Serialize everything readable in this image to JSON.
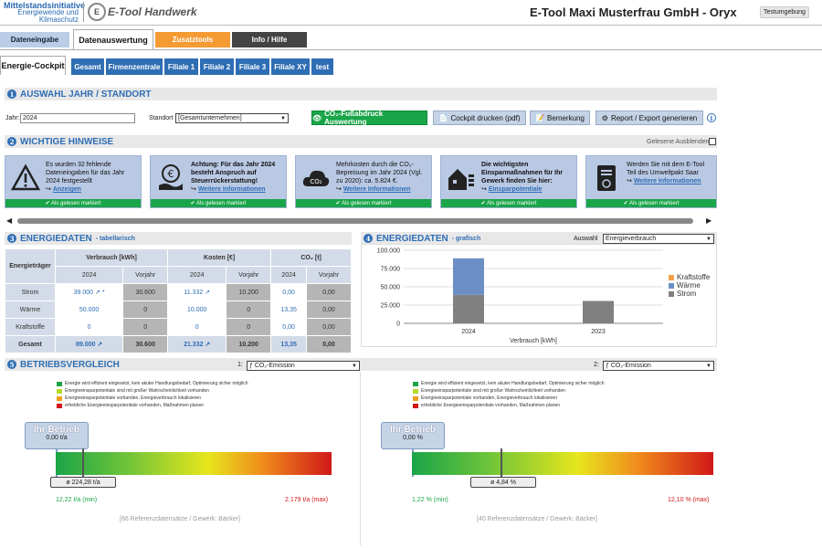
{
  "header": {
    "logo_line1": "Mittelstandsinitiative",
    "logo_line2": "Energiewende und",
    "logo_line3": "Klimaschutz",
    "logo2_mark": "E",
    "logo2_text": "E-Tool Handwerk",
    "app_title": "E-Tool Maxi Musterfrau GmbH - Oryx",
    "env_badge": "Testumgebung"
  },
  "main_tabs": [
    "Dateneingabe",
    "Datenauswertung",
    "Zusatztools",
    "Info / Hilfe"
  ],
  "sub_tabs": [
    "Energie-Cockpit",
    "Gesamt",
    "Firmenzentrale",
    "Filiale 1",
    "Filiale 2",
    "Filiale 3",
    "Filiale XY",
    "test"
  ],
  "section1": {
    "num": "1",
    "title": "AUSWAHL JAHR / STANDORT",
    "jahr_label": "Jahr:",
    "jahr_value": "2024",
    "standort_label": "Standort",
    "standort_value": "[Gesamtunternehmen]",
    "btn_co2": "CO₂-Fußabdruck Auswertung",
    "btn_print": "Cockpit drucken (pdf)",
    "btn_note": "Bemerkung",
    "btn_report": "Report / Export generieren",
    "info": "i"
  },
  "section2": {
    "num": "2",
    "title": "WICHTIGE HINWEISE",
    "hide_read": "Gelesene Ausblenden",
    "read_label": "✔ Als gelesen markiert",
    "cards": [
      {
        "text": "Es wurden 32 fehlende Dateneingaben für das Jahr 2024 festgestellt",
        "link": "Anzeigen",
        "icon": "warning-icon"
      },
      {
        "text": "Achtung: Für das Jahr 2024 besteht Anspruch auf Steuerrückerstattung!",
        "link": "Weitere Informationen",
        "icon": "euro-hand-icon"
      },
      {
        "text": "Mehrkosten durch die CO₂-Bepreisung im Jahr 2024 (Vgl. zu 2020): ca. 5.824 €.",
        "link": "Weitere Informationen",
        "icon": "co2-cloud-icon"
      },
      {
        "text": "Die wichtigsten Einsparmaßnahmen für Ihr Gewerk finden Sie hier:",
        "link": "Einsparpotentiale",
        "icon": "house-efficiency-icon"
      },
      {
        "text": "Werden Sie mit dem E-Tool Teil des Umweltpakt Saar",
        "link": "Weitere Informationen",
        "icon": "certificate-icon"
      }
    ]
  },
  "section3": {
    "num": "3",
    "title": "ENERGIEDATEN",
    "subtitle": "- tabellarisch",
    "col_energy": "Energieträger",
    "groups": [
      "Verbrauch [kWh]",
      "Kosten [€]",
      "CO₂ [t]"
    ],
    "years": [
      "2024",
      "Vorjahr",
      "2024",
      "Vorjahr",
      "2024",
      "Vorjahr"
    ],
    "rows": [
      {
        "name": "Strom",
        "cells": [
          "39.000 ↗ *",
          "30.600",
          "11.332 ↗",
          "10.200",
          "0,00",
          "0,00"
        ]
      },
      {
        "name": "Wärme",
        "cells": [
          "50.000",
          "0",
          "10.000",
          "0",
          "13,35",
          "0,00"
        ]
      },
      {
        "name": "Kraftstoffe",
        "cells": [
          "0",
          "0",
          "0",
          "0",
          "0,00",
          "0,00"
        ]
      },
      {
        "name": "Gesamt",
        "cells": [
          "89.000 ↗",
          "30.600",
          "21.332 ↗",
          "10.200",
          "13,35",
          "0,00"
        ]
      }
    ]
  },
  "section4": {
    "num": "4",
    "title": "ENERGIEDATEN",
    "subtitle": "- grafisch",
    "select_label": "Auswahl",
    "select_value": "Energieverbrauch"
  },
  "chart_data": {
    "type": "bar",
    "stacked": true,
    "categories": [
      "2024",
      "2023"
    ],
    "xlabel": "Verbrauch [kWh]",
    "ylim": [
      0,
      100000
    ],
    "yticks": [
      "0",
      "25.000",
      "50.000",
      "75.000",
      "100.000"
    ],
    "grid": true,
    "legend_position": "right",
    "series": [
      {
        "name": "Strom",
        "values": [
          39000,
          30600
        ],
        "color": "#808080"
      },
      {
        "name": "Wärme",
        "values": [
          50000,
          0
        ],
        "color": "#6b8fc4"
      },
      {
        "name": "Kraftstoffe",
        "values": [
          0,
          0
        ],
        "color": "#f0a14a"
      }
    ]
  },
  "section5": {
    "num": "5",
    "title": "BETRIEBSVERGLEICH",
    "legend": [
      {
        "color": "#1aa548",
        "text": "Energie wird effizient eingesetzt, kein akuter Handlungsbedarf, Optimierung sicher möglich"
      },
      {
        "color": "#b8d82a",
        "text": "Energieeinsparpotentiale sind mit großer Wahrscheinlichkeit vorhanden"
      },
      {
        "color": "#f0a020",
        "text": "Energieeinsparpotentiale vorhanden, Energieverbrauch lokalisieren"
      },
      {
        "color": "#d01818",
        "text": "erhebliche Energieeinsparpotentiale vorhanden, Maßnahmen planen"
      }
    ],
    "left": {
      "index": "1:",
      "select": "ƒ CO₂-Emission",
      "bubble": "Ihr Betrieb",
      "value": "0,00 t/a",
      "avg": "ø 224,28 t/a",
      "min": "12,22 t/a (min)",
      "max": "2.179 t/a (max)",
      "ref": "[66 Referenzdatensätze / Gewerk: Bäcker]"
    },
    "right": {
      "index": "2:",
      "select": "ƒ CO₂-Emission",
      "bubble": "Ihr Betrieb",
      "value": "0,00 %",
      "avg": "ø 4,84 %",
      "min": "1,22 % (min)",
      "max": "12,10 % (max)",
      "ref": "[40 Referenzdatensätze / Gewerk: Bäcker]"
    }
  }
}
